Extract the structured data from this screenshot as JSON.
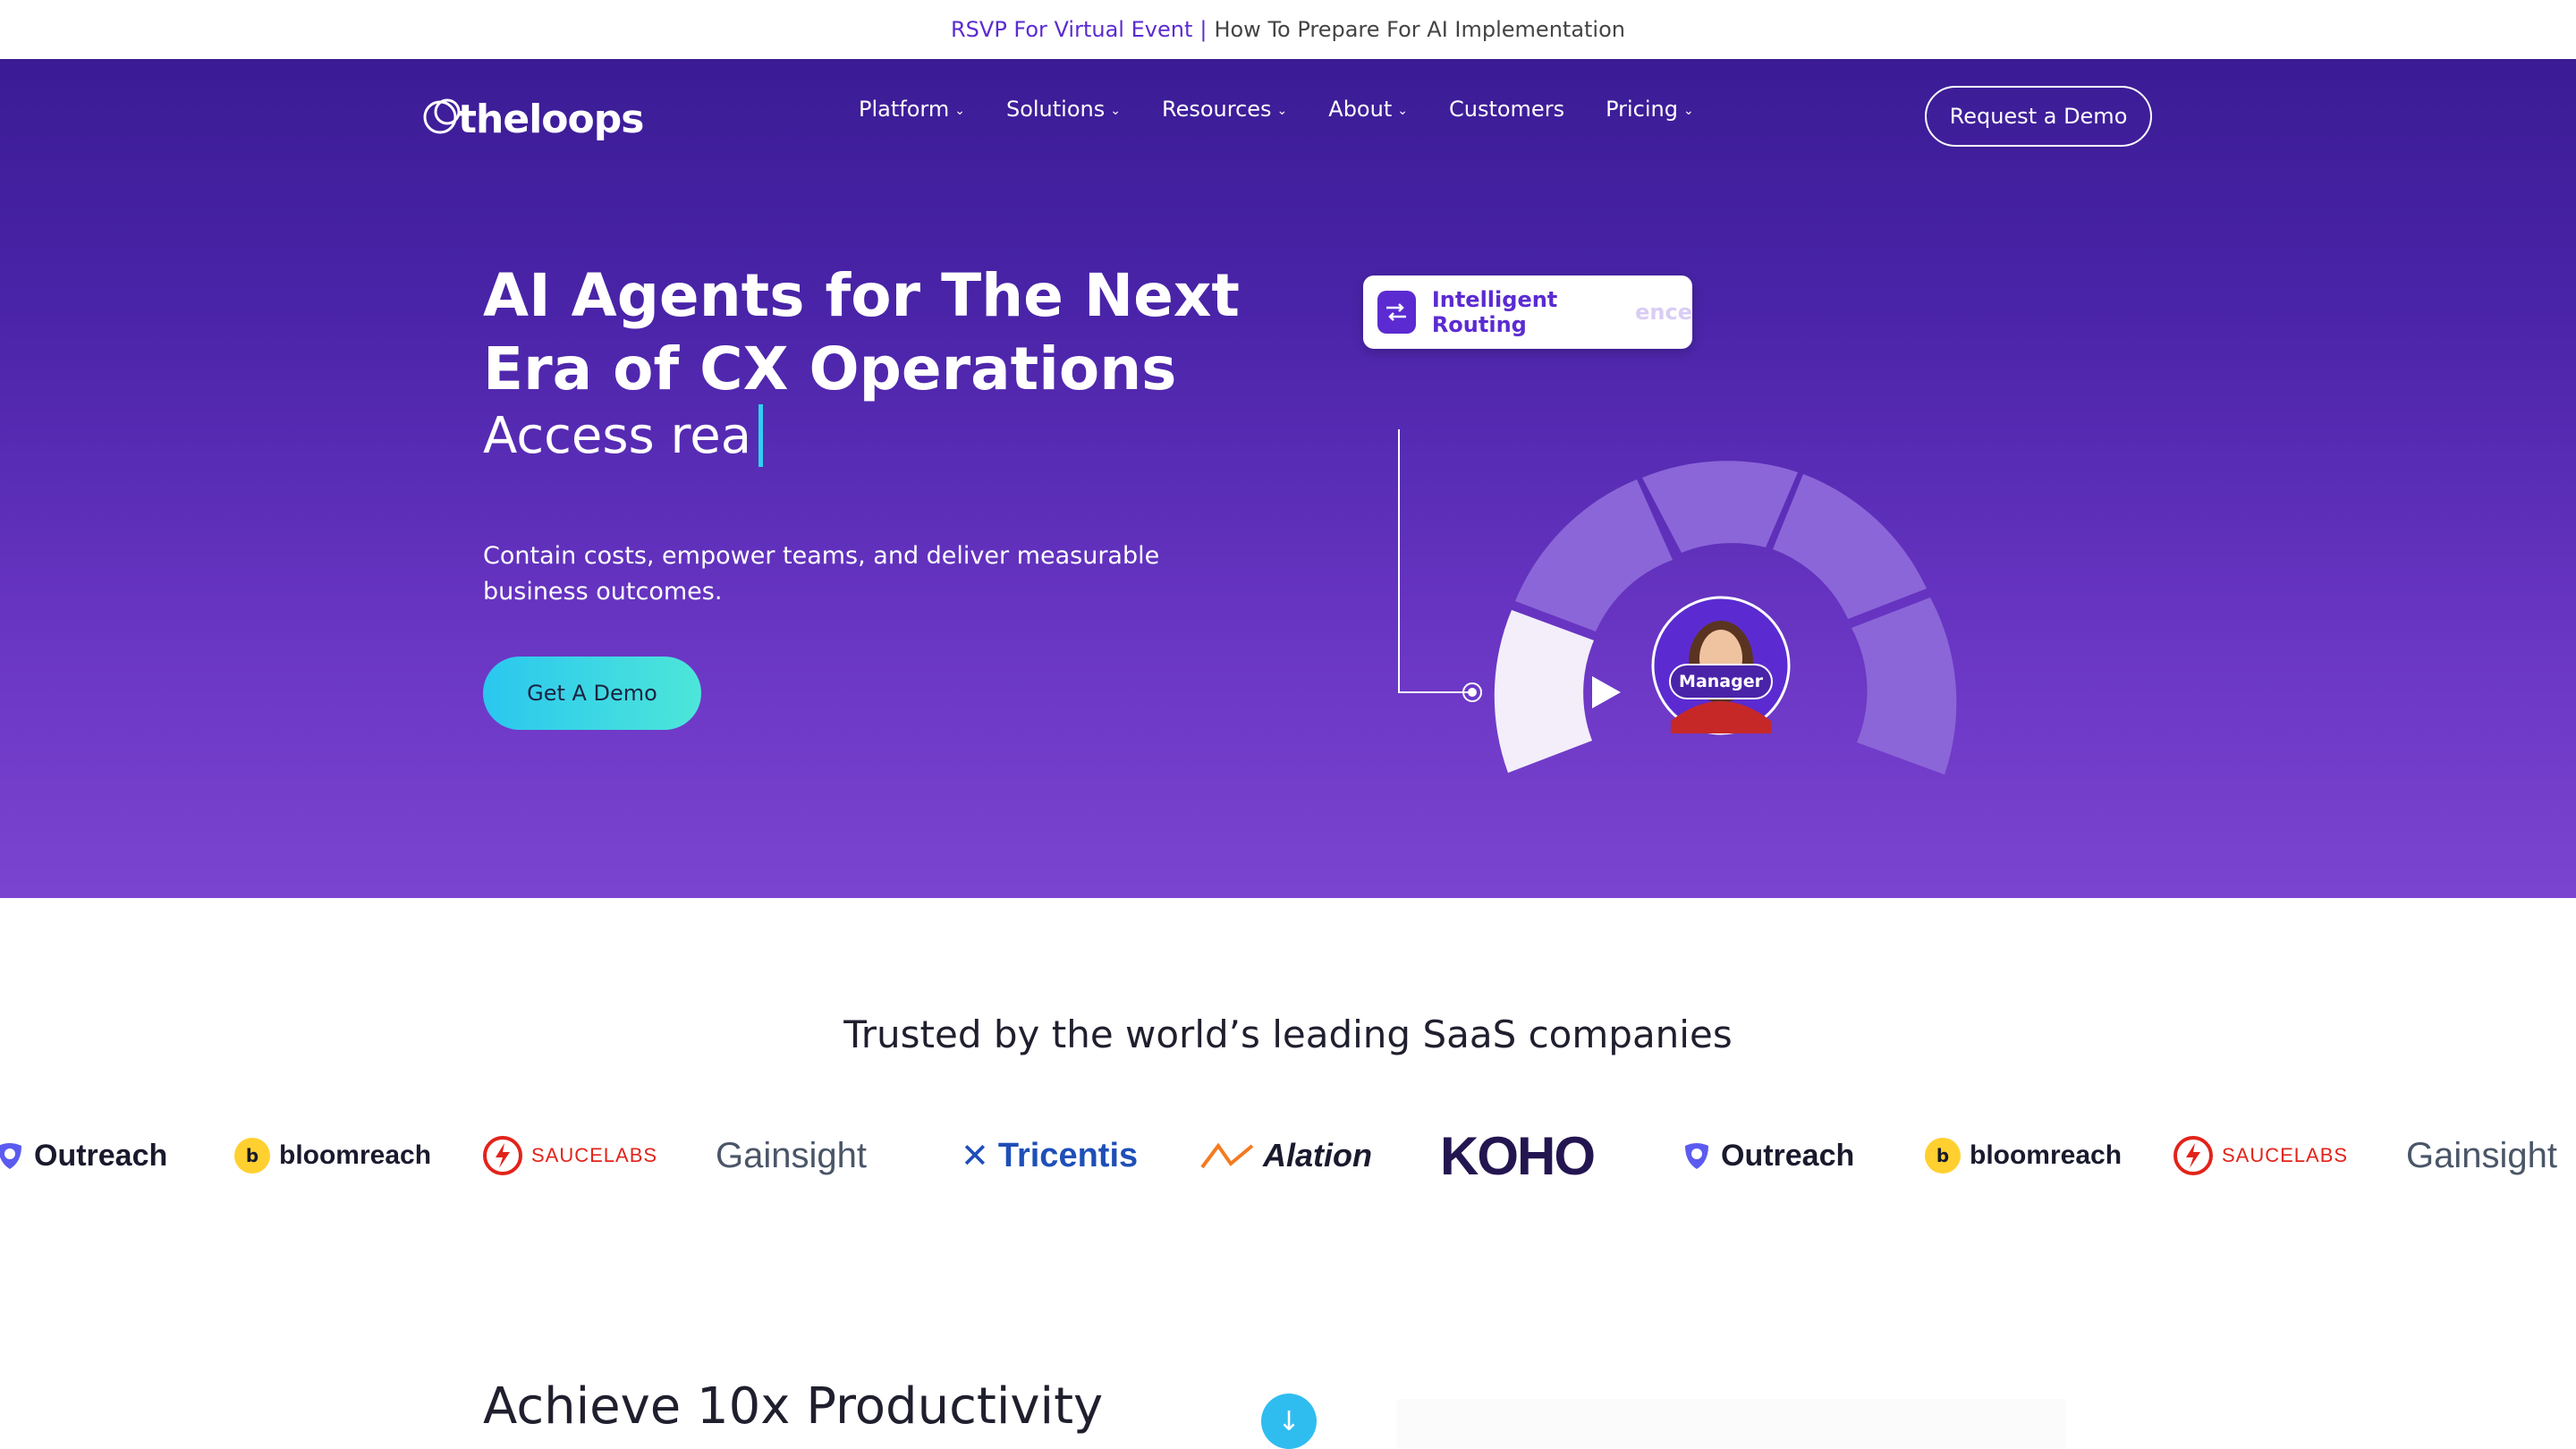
{
  "banner": {
    "rsvp": "RSVP For Virtual Event",
    "separator": "|",
    "text": "How To Prepare For AI Implementation"
  },
  "nav": {
    "logo_text": "theloops",
    "items": [
      {
        "label": "Platform",
        "dropdown": true
      },
      {
        "label": "Solutions",
        "dropdown": true
      },
      {
        "label": "Resources",
        "dropdown": true
      },
      {
        "label": "About",
        "dropdown": true
      },
      {
        "label": "Customers",
        "dropdown": false
      },
      {
        "label": "Pricing",
        "dropdown": true
      }
    ],
    "cta": "Request a Demo"
  },
  "hero": {
    "title": "AI Agents for The Next Era of CX Operations",
    "typed": "Access rea",
    "subtitle": "Contain costs, empower teams, and deliver measurable business outcomes.",
    "cta": "Get A Demo"
  },
  "graphic": {
    "card_label": "Intelligent Routing",
    "card_ghost": "ence",
    "badge": "Manager"
  },
  "trusted": {
    "heading": "Trusted by the world’s leading SaaS companies",
    "logos": [
      "Outreach",
      "bloomreach",
      "SAUCELABS",
      "Gainsight",
      "Tricentis",
      "Alation",
      "KOHO",
      "Outreach",
      "bloomreach",
      "SAUCELABS",
      "Gainsight"
    ]
  },
  "section": {
    "heading": "Achieve 10x Productivity",
    "scroll_icon": "arrow-down-icon"
  },
  "colors": {
    "brand": "#5b2bd1",
    "hero_top": "#3b1c95",
    "hero_bottom": "#7b44d0",
    "cta_start": "#2ac7ef",
    "cta_end": "#4de6d9"
  }
}
